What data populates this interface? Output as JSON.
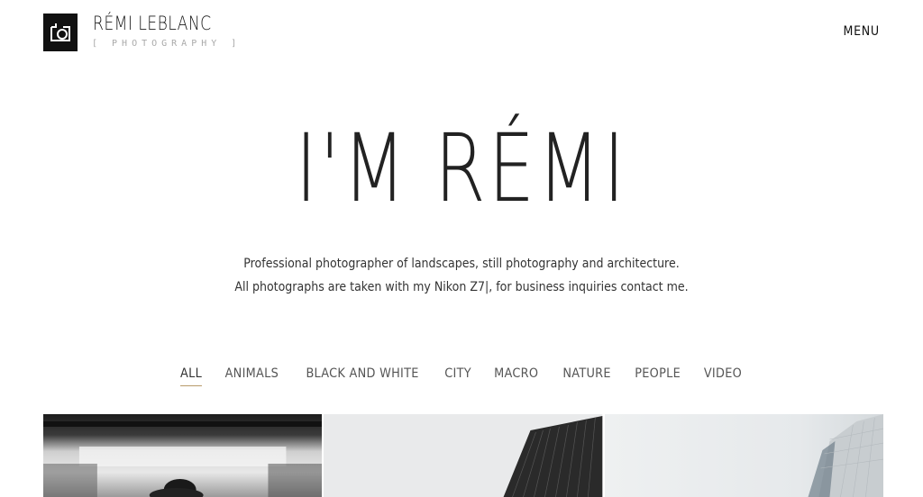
{
  "header": {
    "brand_name": "RÉMI LEBLANC",
    "brand_tag": "[ PHOTOGRAPHY ]",
    "menu_label": "MENU",
    "logo_icon": "camera-icon"
  },
  "hero": {
    "title": "I'M RÉMI",
    "line1": "Professional photographer of landscapes, still photography and architecture.",
    "line2": "All photographs are taken with my Nikon Z7|, for business inquiries contact me."
  },
  "filters": {
    "active": "ALL",
    "items": [
      "ALL",
      "ANIMALS",
      "BLACK AND WHITE",
      "CITY",
      "MACRO",
      "NATURE",
      "PEOPLE",
      "VIDEO"
    ]
  },
  "colors": {
    "accent": "#b89b6a",
    "text": "#1f1f1f",
    "logo_bg": "#111111"
  },
  "gallery": {
    "tiles": [
      "photo-person-motion-blur",
      "photo-dark-building-facade",
      "photo-glass-tower-fog"
    ]
  }
}
